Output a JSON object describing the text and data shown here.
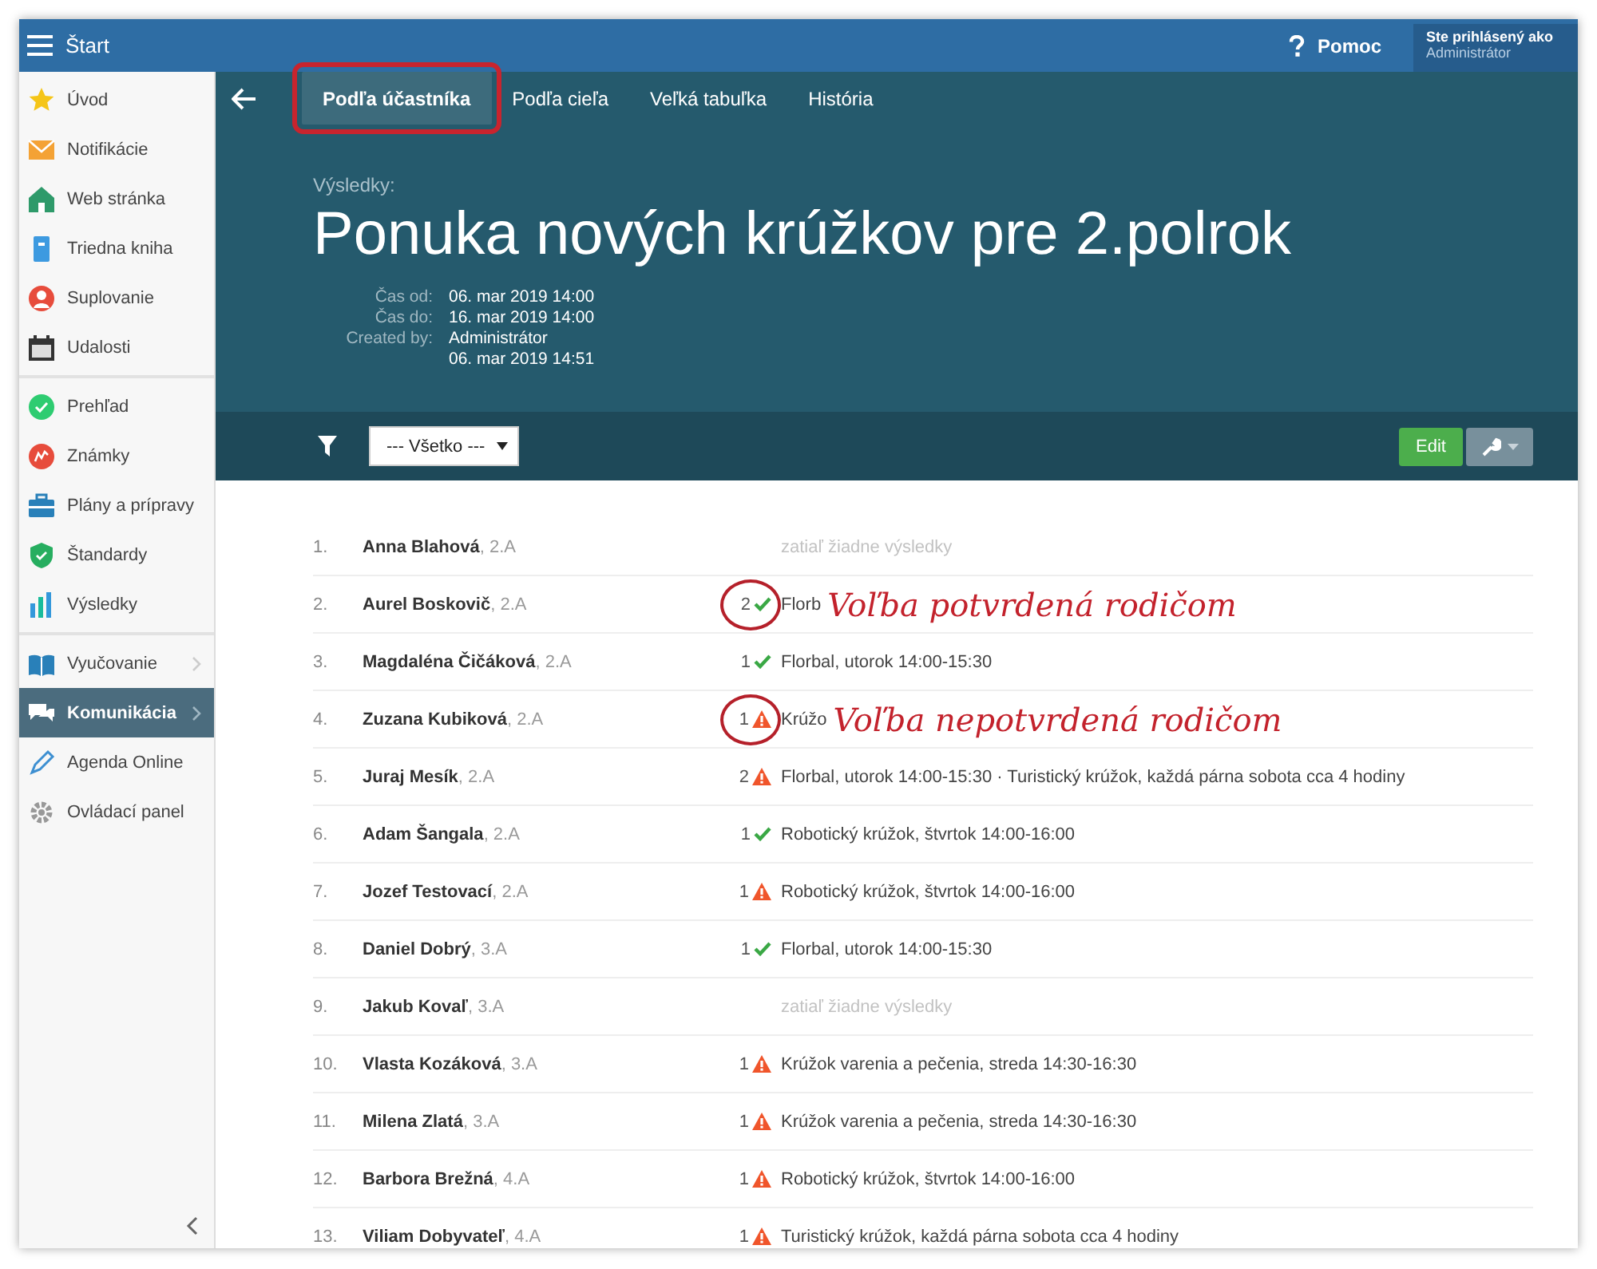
{
  "topbar": {
    "title": "Štart",
    "help": "Pomoc",
    "login_label": "Ste prihlásený ako",
    "login_user": "Administrátor"
  },
  "sidebar": {
    "groups": [
      [
        {
          "label": "Úvod",
          "selected": false,
          "has_submenu": false
        },
        {
          "label": "Notifikácie",
          "selected": false,
          "has_submenu": false
        },
        {
          "label": "Web stránka",
          "selected": false,
          "has_submenu": false
        },
        {
          "label": "Triedna kniha",
          "selected": false,
          "has_submenu": false
        },
        {
          "label": "Suplovanie",
          "selected": false,
          "has_submenu": false
        },
        {
          "label": "Udalosti",
          "selected": false,
          "has_submenu": false
        }
      ],
      [
        {
          "label": "Prehľad",
          "selected": false,
          "has_submenu": false
        },
        {
          "label": "Známky",
          "selected": false,
          "has_submenu": false
        },
        {
          "label": "Plány a prípravy",
          "selected": false,
          "has_submenu": false
        },
        {
          "label": "Štandardy",
          "selected": false,
          "has_submenu": false
        },
        {
          "label": "Výsledky",
          "selected": false,
          "has_submenu": false
        }
      ],
      [
        {
          "label": "Vyučovanie",
          "selected": false,
          "has_submenu": true
        },
        {
          "label": "Komunikácia",
          "selected": true,
          "has_submenu": true
        },
        {
          "label": "Agenda Online",
          "selected": false,
          "has_submenu": false
        },
        {
          "label": "Ovládací panel",
          "selected": false,
          "has_submenu": false
        }
      ]
    ]
  },
  "tabs": [
    {
      "label": "Podľa účastníka",
      "selected": true,
      "highlighted": true
    },
    {
      "label": "Podľa cieľa",
      "selected": false,
      "highlighted": false
    },
    {
      "label": "Veľká tabuľka",
      "selected": false,
      "highlighted": false
    },
    {
      "label": "História",
      "selected": false,
      "highlighted": false
    }
  ],
  "header": {
    "kicker": "Výsledky:",
    "title": "Ponuka nových krúžkov pre 2.polrok",
    "meta": [
      {
        "label": "Čas od:",
        "lines": [
          "06. mar 2019 14:00"
        ]
      },
      {
        "label": "Čas do:",
        "lines": [
          "16. mar 2019 14:00"
        ]
      },
      {
        "label": "Created by:",
        "lines": [
          "Administrátor",
          "06. mar 2019 14:51"
        ]
      }
    ]
  },
  "toolbar": {
    "filter_value": "--- Všetko ---",
    "edit": "Edit"
  },
  "rows": [
    {
      "number": "1.",
      "name": "Anna Blahová",
      "class": ", 2.A",
      "kind": "none",
      "results": "zatiaľ žiadne výsledky"
    },
    {
      "number": "2.",
      "name": "Aurel Boskovič",
      "class": ", 2.A",
      "count": "2",
      "kind": "confirmed",
      "results": "Florb",
      "circled": true,
      "note": "Voľba potvrdená rodičom"
    },
    {
      "number": "3.",
      "name": "Magdaléna Čičáková",
      "class": ", 2.A",
      "count": "1",
      "kind": "confirmed",
      "results": "Florbal, utorok 14:00-15:30"
    },
    {
      "number": "4.",
      "name": "Zuzana Kubiková",
      "class": ", 2.A",
      "count": "1",
      "kind": "unconfirmed",
      "results": "Krúžo",
      "circled": true,
      "note": "Voľba nepotvrdená rodičom"
    },
    {
      "number": "5.",
      "name": "Juraj Mesík",
      "class": ", 2.A",
      "count": "2",
      "kind": "unconfirmed",
      "results": "Florbal, utorok 14:00-15:30 · Turistický krúžok, každá párna sobota cca 4 hodiny"
    },
    {
      "number": "6.",
      "name": "Adam Šangala",
      "class": ", 2.A",
      "count": "1",
      "kind": "confirmed",
      "results": "Robotický krúžok, štvrtok 14:00-16:00"
    },
    {
      "number": "7.",
      "name": "Jozef Testovací",
      "class": ", 2.A",
      "count": "1",
      "kind": "unconfirmed",
      "results": "Robotický krúžok, štvrtok 14:00-16:00"
    },
    {
      "number": "8.",
      "name": "Daniel Dobrý",
      "class": ", 3.A",
      "count": "1",
      "kind": "confirmed",
      "results": "Florbal, utorok 14:00-15:30"
    },
    {
      "number": "9.",
      "name": "Jakub Kovaľ",
      "class": ", 3.A",
      "kind": "none",
      "results": "zatiaľ žiadne výsledky"
    },
    {
      "number": "10.",
      "name": "Vlasta Kozáková",
      "class": ", 3.A",
      "count": "1",
      "kind": "unconfirmed",
      "results": "Krúžok varenia a pečenia, streda 14:30-16:30"
    },
    {
      "number": "11.",
      "name": "Milena Zlatá",
      "class": ", 3.A",
      "count": "1",
      "kind": "unconfirmed",
      "results": "Krúžok varenia a pečenia, streda 14:30-16:30"
    },
    {
      "number": "12.",
      "name": "Barbora Brežná",
      "class": ", 4.A",
      "count": "1",
      "kind": "unconfirmed",
      "results": "Robotický krúžok, štvrtok 14:00-16:00"
    },
    {
      "number": "13.",
      "name": "Viliam Dobyvateľ",
      "class": ", 4.A",
      "count": "1",
      "kind": "unconfirmed",
      "results": "Turistický krúžok, každá párna sobota cca 4 hodiny"
    }
  ]
}
